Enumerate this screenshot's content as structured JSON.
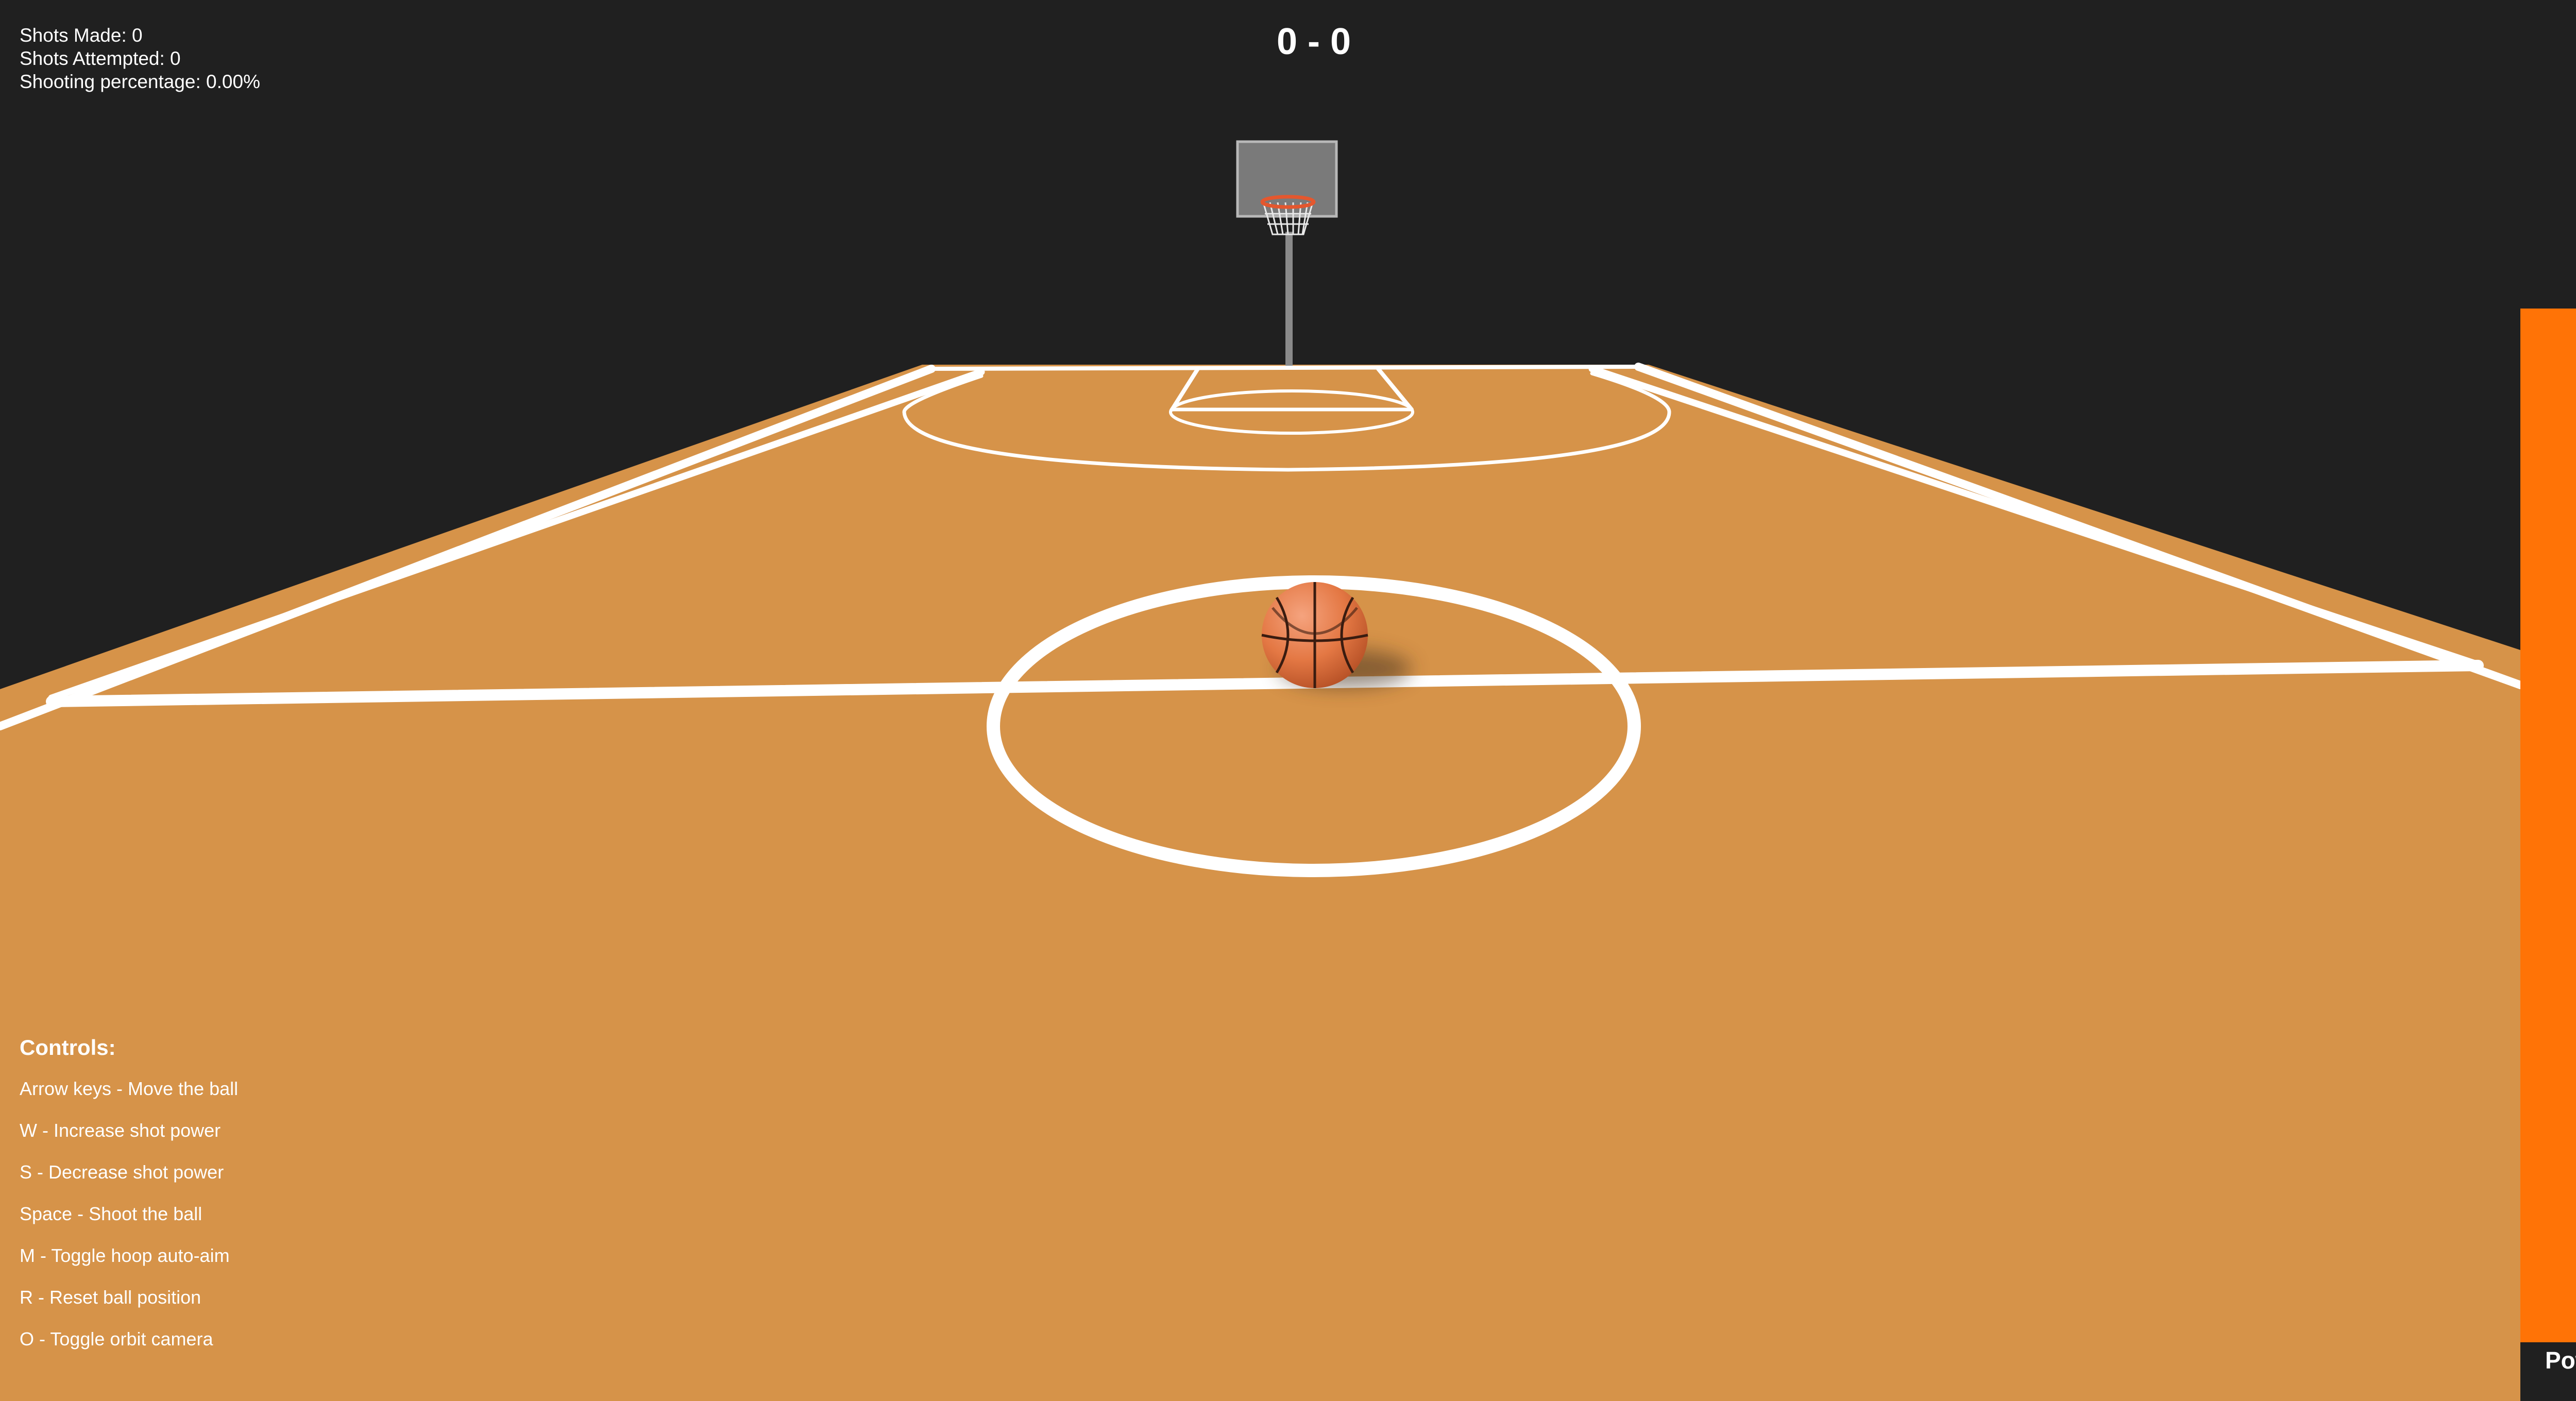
{
  "stats": {
    "shots_made": "Shots Made: 0",
    "shots_attempted": "Shots Attempted: 0",
    "shooting_percentage": "Shooting percentage: 0.00%"
  },
  "score": "0 - 0",
  "controls": {
    "title": "Controls:",
    "items": [
      "Arrow keys - Move the ball",
      "W - Increase shot power",
      "S - Decrease shot power",
      "Space - Shoot the ball",
      "M - Toggle hoop auto-aim",
      "R - Reset ball position",
      "O - Toggle orbit camera"
    ]
  },
  "power": {
    "label": "Power",
    "level": 0.77,
    "color": "#ff7306"
  },
  "colors": {
    "background": "#202020",
    "court": "#d69349",
    "lines": "#ffffff",
    "ball": "#e87a45",
    "backboard": "#7a7a7a",
    "rim": "#e4572e"
  }
}
